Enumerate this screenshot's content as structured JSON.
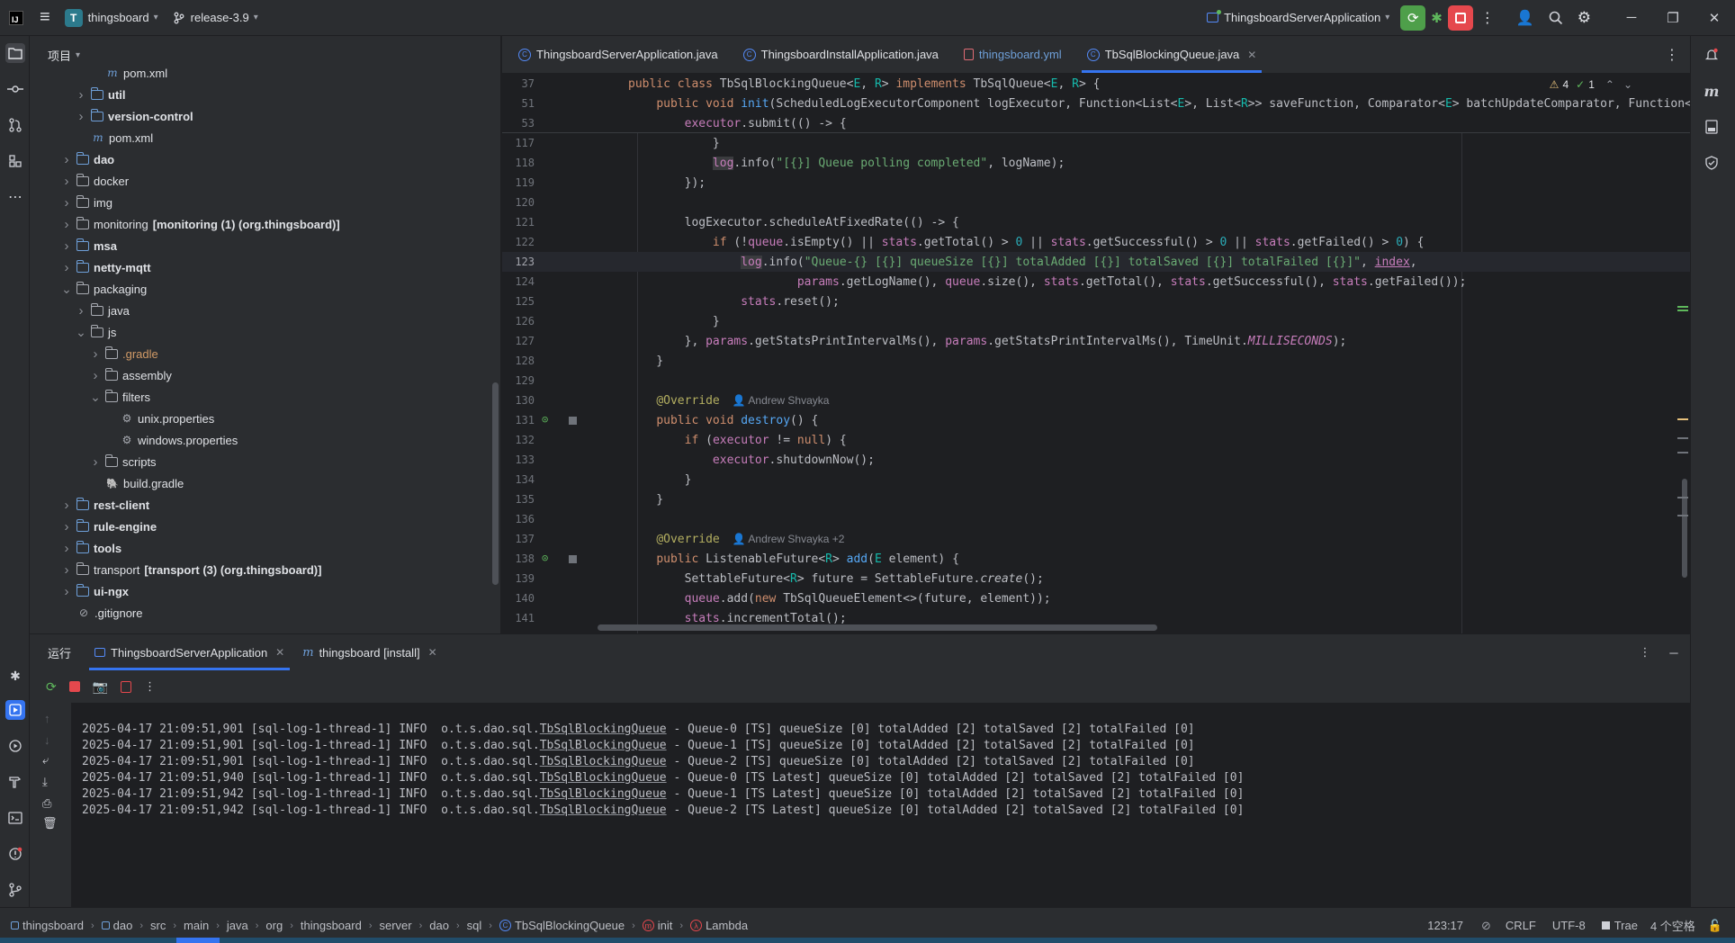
{
  "titlebar": {
    "project": "thingsboard",
    "project_badge": "T",
    "branch": "release-3.9",
    "run_config": "ThingsboardServerApplication"
  },
  "project_panel": {
    "title": "项目",
    "tree": [
      {
        "label": "pom.xml",
        "kind": "maven",
        "indent": 5,
        "arrow": ""
      },
      {
        "label": "util",
        "kind": "module",
        "indent": 4,
        "arrow": ">",
        "bold": true
      },
      {
        "label": "version-control",
        "kind": "module",
        "indent": 4,
        "arrow": ">",
        "bold": true
      },
      {
        "label": "pom.xml",
        "kind": "maven",
        "indent": 4,
        "arrow": ""
      },
      {
        "label": "dao",
        "kind": "module",
        "indent": 3,
        "arrow": ">",
        "bold": true
      },
      {
        "label": "docker",
        "kind": "folder",
        "indent": 3,
        "arrow": ">"
      },
      {
        "label": "img",
        "kind": "folder",
        "indent": 3,
        "arrow": ">"
      },
      {
        "label": "monitoring",
        "suffix": "[monitoring (1) (org.thingsboard)]",
        "kind": "folder",
        "indent": 3,
        "arrow": ">"
      },
      {
        "label": "msa",
        "kind": "module",
        "indent": 3,
        "arrow": ">",
        "bold": true
      },
      {
        "label": "netty-mqtt",
        "kind": "module",
        "indent": 3,
        "arrow": ">",
        "bold": true
      },
      {
        "label": "packaging",
        "kind": "folder",
        "indent": 3,
        "arrow": "v"
      },
      {
        "label": "java",
        "kind": "folder",
        "indent": 4,
        "arrow": ">"
      },
      {
        "label": "js",
        "kind": "folder",
        "indent": 4,
        "arrow": "v"
      },
      {
        "label": ".gradle",
        "kind": "folder",
        "indent": 5,
        "arrow": ">",
        "orange": true
      },
      {
        "label": "assembly",
        "kind": "folder",
        "indent": 5,
        "arrow": ">"
      },
      {
        "label": "filters",
        "kind": "folder",
        "indent": 5,
        "arrow": "v"
      },
      {
        "label": "unix.properties",
        "kind": "gear",
        "indent": 6,
        "arrow": ""
      },
      {
        "label": "windows.properties",
        "kind": "gear",
        "indent": 6,
        "arrow": ""
      },
      {
        "label": "scripts",
        "kind": "folder",
        "indent": 5,
        "arrow": ">"
      },
      {
        "label": "build.gradle",
        "kind": "gradle",
        "indent": 5,
        "arrow": ""
      },
      {
        "label": "rest-client",
        "kind": "module",
        "indent": 3,
        "arrow": ">",
        "bold": true
      },
      {
        "label": "rule-engine",
        "kind": "module",
        "indent": 3,
        "arrow": ">",
        "bold": true
      },
      {
        "label": "tools",
        "kind": "module",
        "indent": 3,
        "arrow": ">",
        "bold": true
      },
      {
        "label": "transport",
        "suffix": "[transport (3) (org.thingsboard)]",
        "kind": "folder",
        "indent": 3,
        "arrow": ">"
      },
      {
        "label": "ui-ngx",
        "kind": "module",
        "indent": 3,
        "arrow": ">",
        "bold": true
      },
      {
        "label": ".gitignore",
        "kind": "ignore",
        "indent": 3,
        "arrow": ""
      }
    ]
  },
  "editor_tabs": [
    {
      "label": "ThingsboardServerApplication.java",
      "type": "java",
      "active": false
    },
    {
      "label": "ThingsboardInstallApplication.java",
      "type": "java",
      "active": false
    },
    {
      "label": "thingsboard.yml",
      "type": "yml",
      "active": false
    },
    {
      "label": "TbSqlBlockingQueue.java",
      "type": "java",
      "active": true
    }
  ],
  "inspections": {
    "warnings": "4",
    "ok": "1"
  },
  "authors": {
    "destroy": "Andrew Shvayka",
    "add": "Andrew Shvayka +2"
  },
  "sticky_lines": [
    "37",
    "51",
    "53"
  ],
  "line_numbers": [
    "117",
    "118",
    "119",
    "120",
    "121",
    "122",
    "123",
    "124",
    "125",
    "126",
    "127",
    "128",
    "129",
    "130",
    "131",
    "132",
    "133",
    "134",
    "135",
    "136",
    "137",
    "138",
    "139",
    "140",
    "141"
  ],
  "run_panel": {
    "title": "运行",
    "tabs": [
      {
        "label": "ThingsboardServerApplication",
        "active": true
      },
      {
        "label": "thingsboard [install]",
        "active": false
      }
    ],
    "log": [
      {
        "pre": "2025-04-17 21:09:51,901 [sql-log-1-thread-1] INFO  o.t.s.dao.sql.",
        "cls": "TbSqlBlockingQueue",
        "post": " - Queue-0 [TS] queueSize [0] totalAdded [2] totalSaved [2] totalFailed [0]"
      },
      {
        "pre": "2025-04-17 21:09:51,901 [sql-log-1-thread-1] INFO  o.t.s.dao.sql.",
        "cls": "TbSqlBlockingQueue",
        "post": " - Queue-1 [TS] queueSize [0] totalAdded [2] totalSaved [2] totalFailed [0]"
      },
      {
        "pre": "2025-04-17 21:09:51,901 [sql-log-1-thread-1] INFO  o.t.s.dao.sql.",
        "cls": "TbSqlBlockingQueue",
        "post": " - Queue-2 [TS] queueSize [0] totalAdded [2] totalSaved [2] totalFailed [0]"
      },
      {
        "pre": "2025-04-17 21:09:51,940 [sql-log-1-thread-1] INFO  o.t.s.dao.sql.",
        "cls": "TbSqlBlockingQueue",
        "post": " - Queue-0 [TS Latest] queueSize [0] totalAdded [2] totalSaved [2] totalFailed [0]"
      },
      {
        "pre": "2025-04-17 21:09:51,942 [sql-log-1-thread-1] INFO  o.t.s.dao.sql.",
        "cls": "TbSqlBlockingQueue",
        "post": " - Queue-1 [TS Latest] queueSize [0] totalAdded [2] totalSaved [2] totalFailed [0]"
      },
      {
        "pre": "2025-04-17 21:09:51,942 [sql-log-1-thread-1] INFO  o.t.s.dao.sql.",
        "cls": "TbSqlBlockingQueue",
        "post": " - Queue-2 [TS Latest] queueSize [0] totalAdded [2] totalSaved [2] totalFailed [0]"
      }
    ]
  },
  "statusbar": {
    "breadcrumbs": [
      "thingsboard",
      "dao",
      "src",
      "main",
      "java",
      "org",
      "thingsboard",
      "server",
      "dao",
      "sql",
      "TbSqlBlockingQueue",
      "init",
      "Lambda"
    ],
    "position": "123:17",
    "line_sep": "CRLF",
    "encoding": "UTF-8",
    "trae": "Trae",
    "indent": "4 个空格"
  },
  "colors": {
    "accent": "#3574f0",
    "background": "#1e1f22",
    "panel": "#2b2d30",
    "run_green": "#4e9f4a",
    "stop_red": "#e5484d"
  }
}
